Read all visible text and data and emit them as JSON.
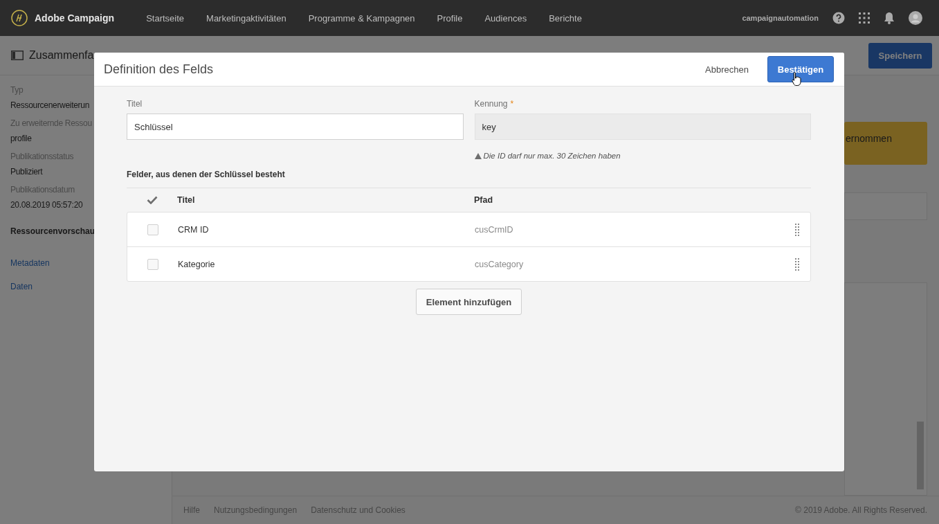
{
  "app_bar": {
    "brand": "Adobe Campaign",
    "nav": [
      "Startseite",
      "Marketingaktivitäten",
      "Programme & Kampagnen",
      "Profile",
      "Audiences",
      "Berichte"
    ],
    "user": "campaignautomation"
  },
  "page": {
    "title": "Zusammenfa",
    "save_button": "Speichern",
    "sidebar": {
      "fields": [
        {
          "label": "Typ",
          "value": "Ressourcenerweiterun"
        },
        {
          "label": "Zu erweiternde Ressou",
          "value": "profile"
        },
        {
          "label": "Publikationsstatus",
          "value": "Publiziert"
        },
        {
          "label": "Publikationsdatum",
          "value": "20.08.2019 05:57:20"
        }
      ],
      "section": "Ressourcenvorschau",
      "links": [
        "Metadaten",
        "Daten"
      ]
    },
    "banner": "ernommen",
    "footer": {
      "links": [
        "Hilfe",
        "Nutzungsbedingungen",
        "Datenschutz und Cookies"
      ],
      "copyright": "© 2019 Adobe. All Rights Reserved."
    }
  },
  "dialog": {
    "title": "Definition des Felds",
    "cancel": "Abbrechen",
    "confirm": "Bestätigen",
    "title_field": {
      "label": "Titel",
      "value": "Schlüssel"
    },
    "id_field": {
      "label": "Kennung",
      "required_mark": "*",
      "value": "key",
      "disabled": true
    },
    "hint": "Die ID darf nur max. 30 Zeichen haben",
    "table": {
      "caption": "Felder, aus denen der Schlüssel besteht",
      "columns": [
        "Titel",
        "Pfad"
      ],
      "rows": [
        {
          "title": "CRM ID",
          "path": "cusCrmID",
          "checked": false
        },
        {
          "title": "Kategorie",
          "path": "cusCategory",
          "checked": false
        }
      ]
    },
    "add_button": "Element hinzufügen"
  }
}
